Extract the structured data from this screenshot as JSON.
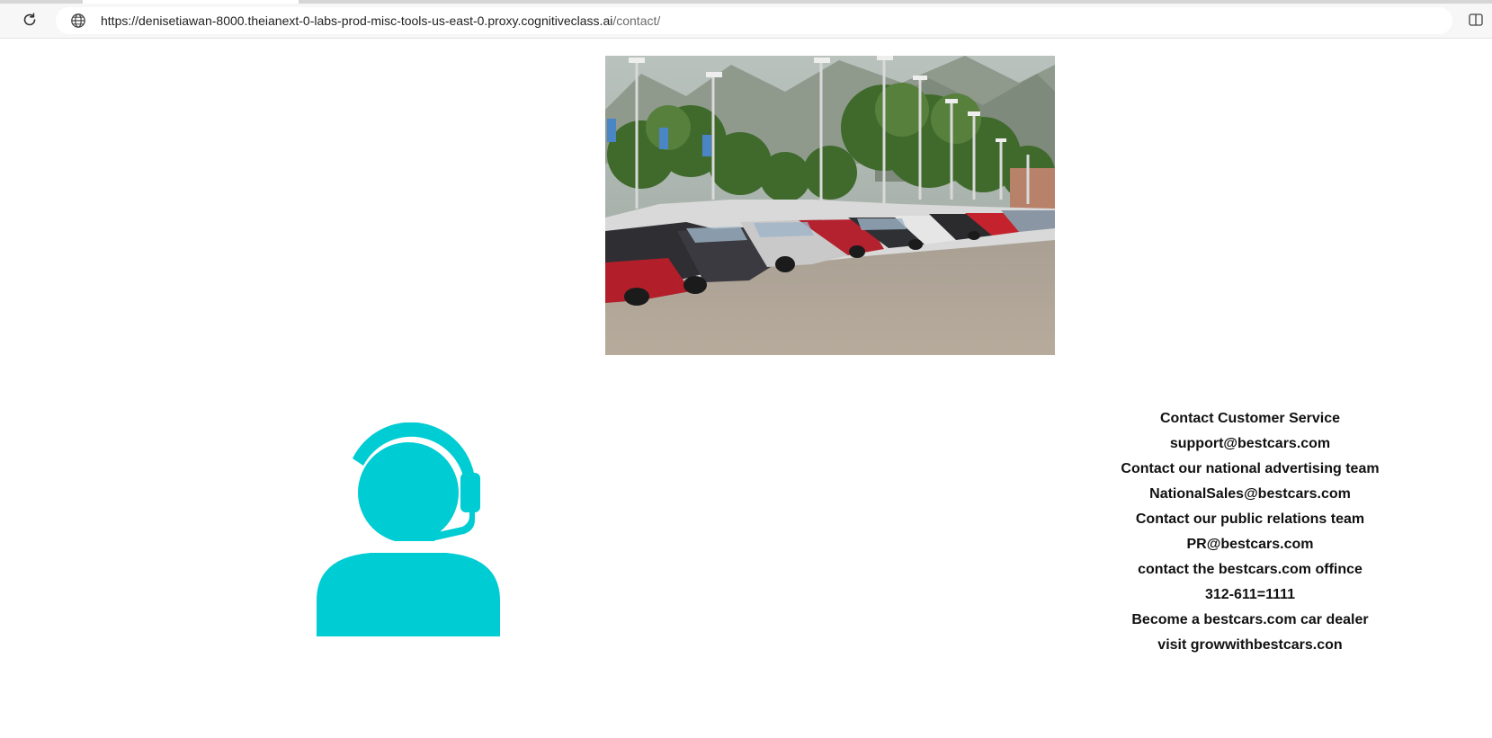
{
  "browser": {
    "url_host": "https://denisetiawan-8000.theianext-0-labs-prod-misc-tools-us-east-0.proxy.cognitiveclass.ai",
    "url_path": "/contact/",
    "icons": {
      "reload": "reload-icon",
      "site": "globe-icon",
      "split": "split-screen-icon"
    }
  },
  "colors": {
    "agent_icon": "#00CCD3",
    "text": "#111111"
  },
  "contact": {
    "lines": [
      "Contact Customer Service",
      "support@bestcars.com",
      "Contact our national advertising team",
      "NationalSales@bestcars.com",
      "Contact our public relations team",
      "PR@bestcars.com",
      "contact the bestcars.com offince",
      "312-611=1111",
      "Become a bestcars.com car dealer",
      "visit growwithbestcars.con"
    ]
  }
}
